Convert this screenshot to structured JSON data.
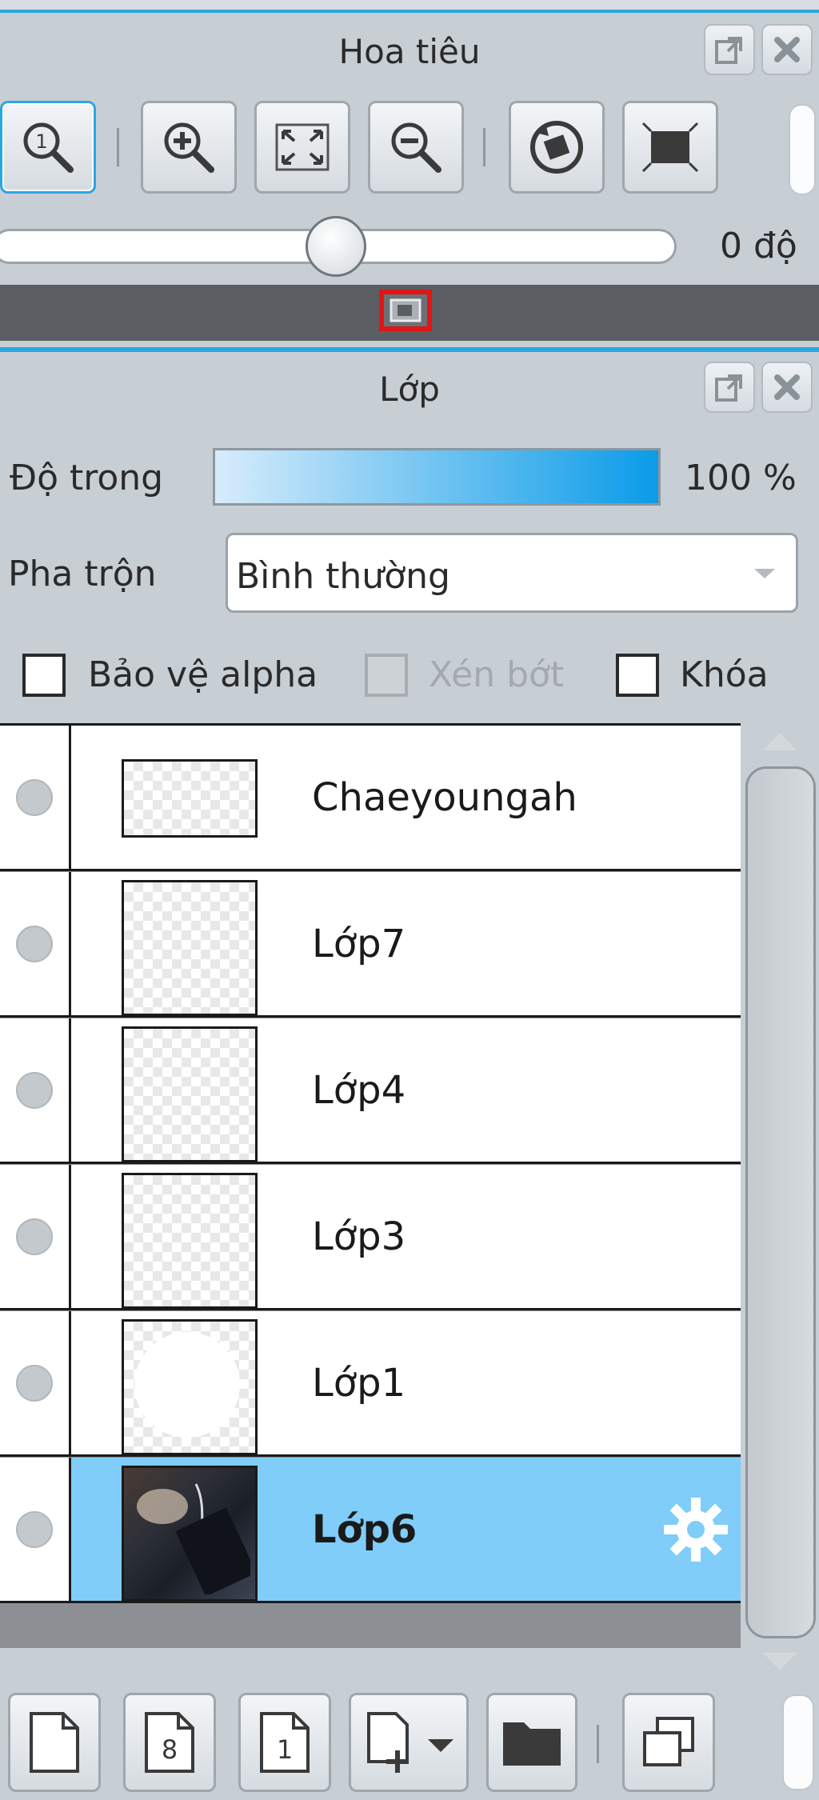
{
  "navigator": {
    "title": "Hoa tiêu",
    "rotation_value": "0 độ",
    "rotation_slider_level": 0.5,
    "tools": [
      "zoom-actual-icon",
      "zoom-in-icon",
      "fit-screen-icon",
      "zoom-out-icon",
      "rotate-reset-icon",
      "flip-icon"
    ]
  },
  "layers_panel": {
    "title": "Lớp",
    "opacity_label": "Độ trong",
    "opacity_value": "100 %",
    "opacity_level": 1.0,
    "blend_label": "Pha trộn",
    "blend_value": "Bình thường",
    "protect_alpha_label": "Bảo vệ alpha",
    "clipping_label": "Xén bớt",
    "lock_label": "Khóa",
    "layers": [
      {
        "name": "Chaeyoungah",
        "selected": false
      },
      {
        "name": "Lớp7",
        "selected": false
      },
      {
        "name": "Lớp4",
        "selected": false
      },
      {
        "name": "Lớp3",
        "selected": false
      },
      {
        "name": "Lớp1",
        "selected": false
      },
      {
        "name": "Lớp6",
        "selected": true
      }
    ],
    "bottom_tools": [
      "new-layer-icon",
      "new-8bit-layer-icon",
      "new-1bit-layer-icon",
      "add-layer-menu-icon",
      "new-folder-icon",
      "duplicate-layer-icon"
    ]
  },
  "colors": {
    "accent": "#2aa6e3",
    "selected_row": "#7fcdf8",
    "panel_bg": "#c7ced4"
  }
}
